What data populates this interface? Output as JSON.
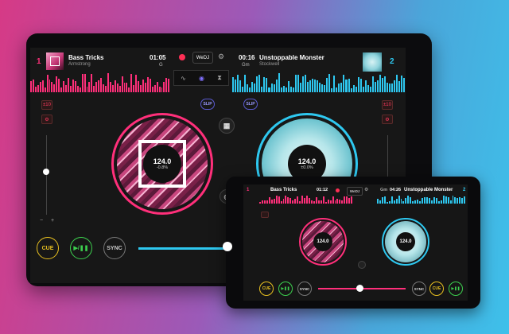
{
  "app": {
    "logo": "WeDJ"
  },
  "deck1": {
    "number": "1",
    "title": "Bass Tricks",
    "artist": "Armstrong",
    "time": "01:05",
    "key": "G",
    "bpm": "124.0",
    "pitch": "-0.8%",
    "pitch_range": "±10",
    "slip": "SLIP"
  },
  "deck2": {
    "number": "2",
    "title": "Unstoppable Monster",
    "artist": "Stockwell",
    "time": "00:16",
    "key": "Gm",
    "bpm": "124.0",
    "pitch": "±0.0%",
    "pitch_range": "±10",
    "slip": "SLIP"
  },
  "controls": {
    "cue": "CUE",
    "sync": "SYNC",
    "minus": "−",
    "plus": "+"
  },
  "phone": {
    "deck1_title": "Bass Tricks",
    "deck1_time": "01:12",
    "logo": "WeDJ",
    "deck2_key": "Gm",
    "deck2_time": "04:26",
    "deck2_title": "Unstoppable Monster",
    "deck1_num": "1",
    "deck2_num": "2",
    "bpm1": "124.0",
    "bpm2": "124.0",
    "cue": "CUE",
    "sync": "SYNC"
  },
  "colors": {
    "deck1": "#ff2f7a",
    "deck2": "#2ec8f0",
    "cue": "#e8c020",
    "play": "#3ccf4e"
  }
}
